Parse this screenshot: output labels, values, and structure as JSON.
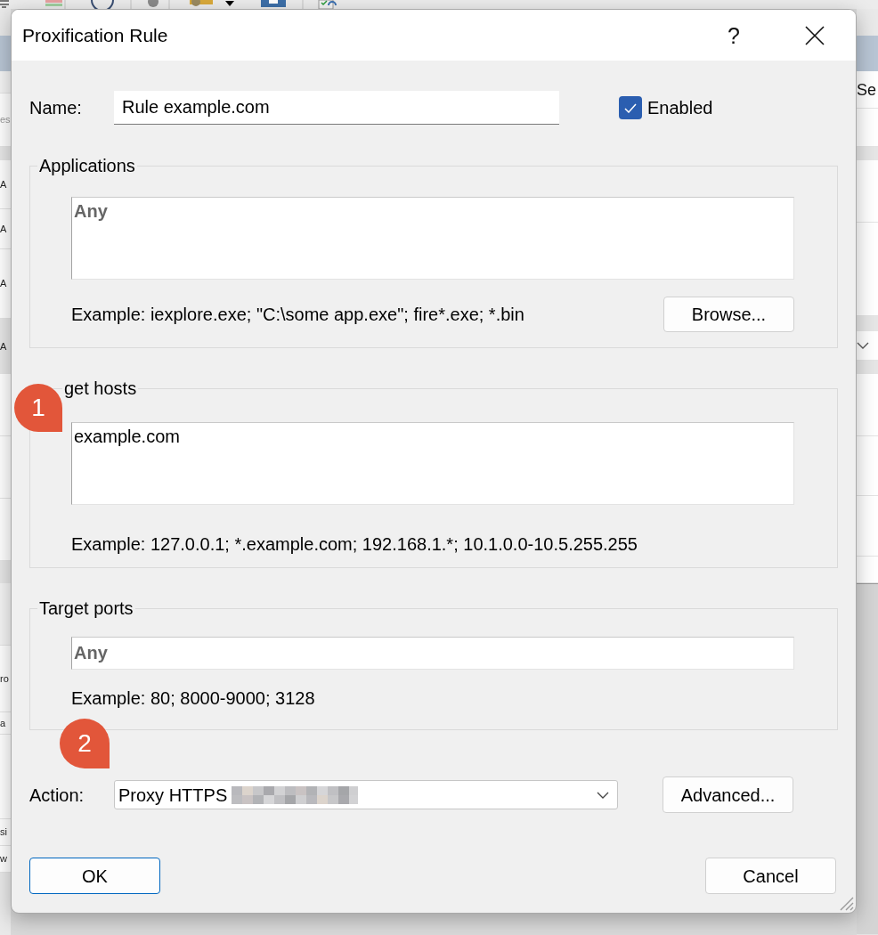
{
  "background_window": {
    "left_texts": [
      "es",
      "A",
      "A",
      "A",
      "A",
      "ro",
      "a",
      "si",
      "w"
    ],
    "right_texts": [
      "Se"
    ]
  },
  "window": {
    "title": "Proxification Rule",
    "help_button": "?"
  },
  "name": {
    "label": "Name:",
    "value": "Rule example.com"
  },
  "enabled": {
    "label": "Enabled",
    "checked": true
  },
  "groups": [
    {
      "title": "Applications",
      "field": {
        "kind": "multiline",
        "placeholder": "Any"
      },
      "example": "Example: iexplore.exe; \"C:\\some app.exe\"; fire*.exe; *.bin",
      "button": "Browse..."
    },
    {
      "title": "get hosts",
      "marker": "1",
      "field": {
        "kind": "multiline",
        "value": "example.com"
      },
      "example": "Example: 127.0.0.1; *.example.com; 192.168.1.*; 10.1.0.0-10.5.255.255"
    },
    {
      "title": "Target ports",
      "field": {
        "kind": "single",
        "placeholder": "Any"
      },
      "example": "Example: 80; 8000-9000; 3128"
    }
  ],
  "action": {
    "label": "Action:",
    "marker": "2",
    "value": "Proxy HTTPS",
    "button": "Advanced..."
  },
  "buttons": [
    {
      "label": "OK",
      "default": true
    },
    {
      "label": "Cancel",
      "default": false
    }
  ]
}
